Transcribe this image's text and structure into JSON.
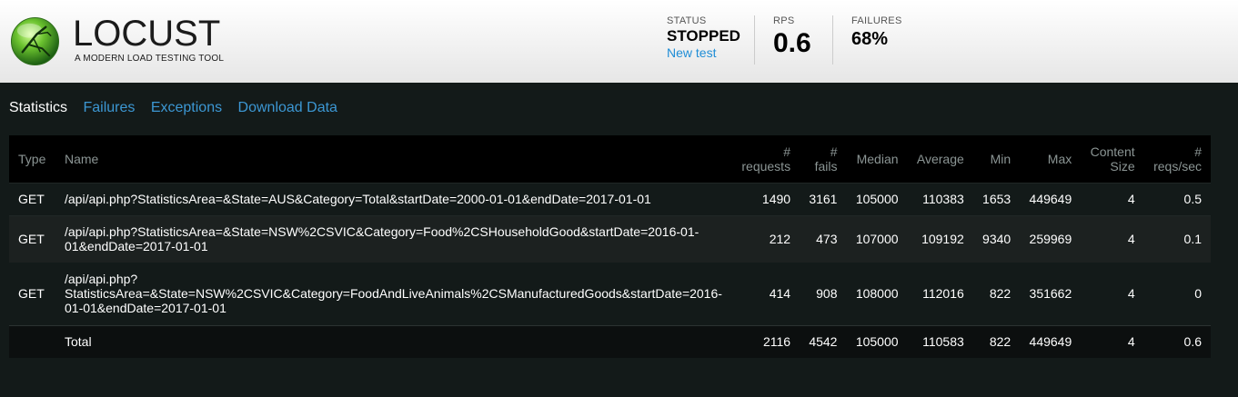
{
  "header": {
    "logo_title": "LOCUST",
    "logo_subtitle": "A MODERN LOAD TESTING TOOL",
    "status_label": "STATUS",
    "status_value": "STOPPED",
    "new_test_link": "New test",
    "rps_label": "RPS",
    "rps_value": "0.6",
    "failures_label": "FAILURES",
    "failures_value": "68%"
  },
  "tabs": [
    {
      "label": "Statistics",
      "active": true
    },
    {
      "label": "Failures",
      "active": false
    },
    {
      "label": "Exceptions",
      "active": false
    },
    {
      "label": "Download Data",
      "active": false
    }
  ],
  "table": {
    "headers": {
      "type": "Type",
      "name": "Name",
      "requests_1": "#",
      "requests_2": "requests",
      "fails_1": "#",
      "fails_2": "fails",
      "median": "Median",
      "average": "Average",
      "min": "Min",
      "max": "Max",
      "content_1": "Content",
      "content_2": "Size",
      "reqs_1": "#",
      "reqs_2": "reqs/sec"
    },
    "rows": [
      {
        "type": "GET",
        "name": "/api/api.php?StatisticsArea=&State=AUS&Category=Total&startDate=2000-01-01&endDate=2017-01-01",
        "requests": "1490",
        "fails": "3161",
        "median": "105000",
        "average": "110383",
        "min": "1653",
        "max": "449649",
        "content_size": "4",
        "reqs_sec": "0.5"
      },
      {
        "type": "GET",
        "name_line1": "/api/api.php?StatisticsArea=&State=NSW%2CSVIC&Category=Food%2CSHouseholdGood&startDate=2016-01-",
        "name_line2": "01&endDate=2017-01-01",
        "requests": "212",
        "fails": "473",
        "median": "107000",
        "average": "109192",
        "min": "9340",
        "max": "259969",
        "content_size": "4",
        "reqs_sec": "0.1"
      },
      {
        "type": "GET",
        "name_line1": "/api/api.php?",
        "name_line2": "StatisticsArea=&State=NSW%2CSVIC&Category=FoodAndLiveAnimals%2CSManufacturedGoods&startDate=2016-",
        "name_line3": "01-01&endDate=2017-01-01",
        "requests": "414",
        "fails": "908",
        "median": "108000",
        "average": "112016",
        "min": "822",
        "max": "351662",
        "content_size": "4",
        "reqs_sec": "0"
      }
    ],
    "total": {
      "type": "",
      "name": "Total",
      "requests": "2116",
      "fails": "4542",
      "median": "105000",
      "average": "110583",
      "min": "822",
      "max": "449649",
      "content_size": "4",
      "reqs_sec": "0.6"
    }
  },
  "colors": {
    "accent_link": "#1f8dd6",
    "tab_link": "#3c97d3",
    "background": "#131a19",
    "header_bg": "#ffffff"
  },
  "icons": {
    "logo": "locust-logo-icon"
  }
}
